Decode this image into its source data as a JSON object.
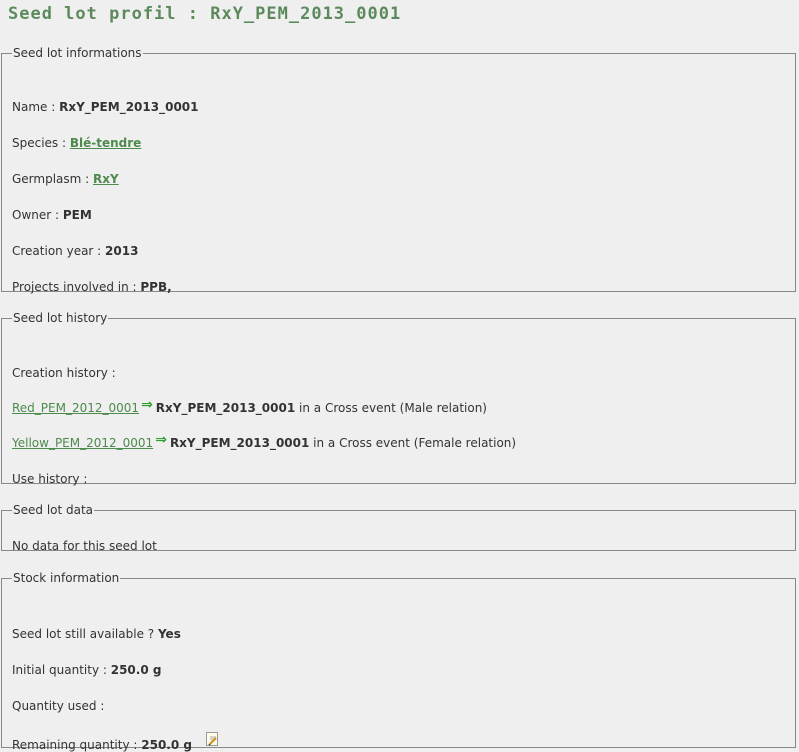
{
  "page_title": "Seed lot profil : RxY_PEM_2013_0001",
  "info": {
    "legend": "Seed lot informations",
    "name_label": "Name :",
    "name_value": "RxY_PEM_2013_0001",
    "species_label": "Species :",
    "species_value": "Blé-tendre",
    "germplasm_label": "Germplasm :",
    "germplasm_value": "RxY",
    "owner_label": "Owner :",
    "owner_value": "PEM",
    "year_label": "Creation year :",
    "year_value": "2013",
    "projects_label": "Projects involved in :",
    "projects_value": "PPB,"
  },
  "history": {
    "legend": "Seed lot history",
    "creation_label": "Creation history :",
    "events": [
      {
        "parent": "Red_PEM_2012_0001",
        "child": "RxY_PEM_2013_0001",
        "text": "in a Cross event (Male relation)"
      },
      {
        "parent": "Yellow_PEM_2012_0001",
        "child": "RxY_PEM_2013_0001",
        "text": "in a Cross event (Female relation)"
      }
    ],
    "use_label": "Use history :"
  },
  "data": {
    "legend": "Seed lot data",
    "message": "No data for this seed lot"
  },
  "stock": {
    "legend": "Stock information",
    "available_label": "Seed lot still available ?",
    "available_value": "Yes",
    "initial_label": "Initial quantity :",
    "initial_value": "250.0 g",
    "used_label": "Quantity used :",
    "remaining_label": "Remaining quantity :",
    "remaining_value": "250.0 g"
  },
  "icons": {
    "arrow": "right-arrow-icon",
    "edit": "edit-icon"
  },
  "colors": {
    "title": "#5c8a5c",
    "link": "#4d8a4d",
    "arrow": "#2fa02f",
    "background": "#efefef"
  }
}
